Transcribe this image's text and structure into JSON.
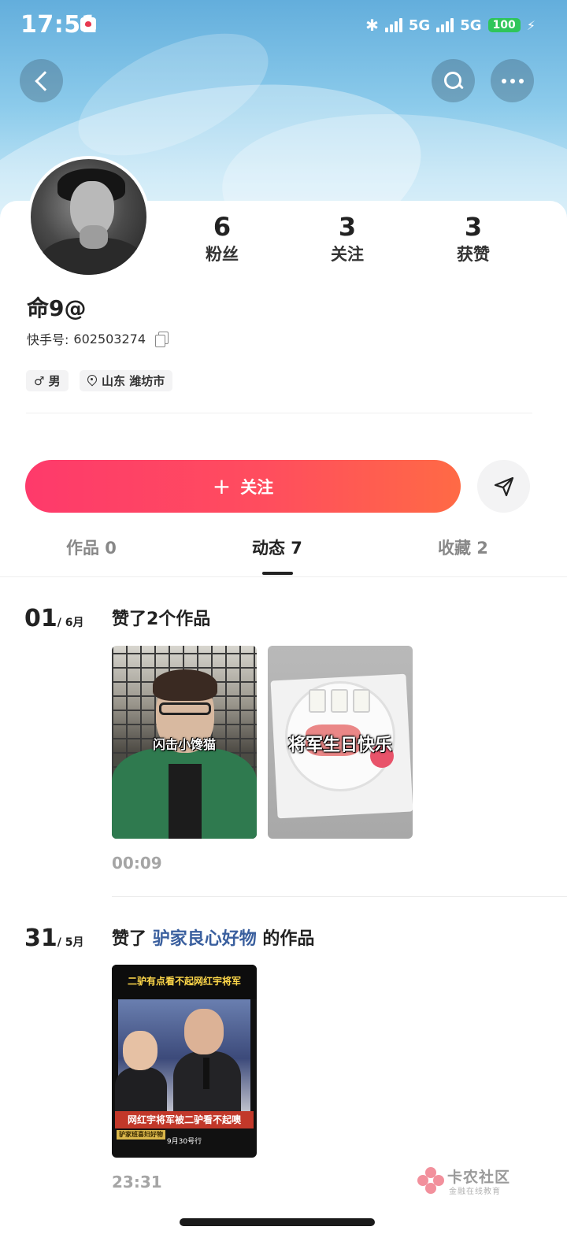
{
  "status_bar": {
    "time": "17:51",
    "network1": "5G",
    "network2": "5G",
    "battery": "100",
    "icons": [
      "bluetooth-icon",
      "signal-icon",
      "battery-icon",
      "charging-icon"
    ]
  },
  "header": {
    "icons": [
      "back-icon",
      "search-icon",
      "more-icon"
    ]
  },
  "profile": {
    "stats": [
      {
        "value": "6",
        "label": "粉丝"
      },
      {
        "value": "3",
        "label": "关注"
      },
      {
        "value": "3",
        "label": "获赞"
      }
    ],
    "nickname": "命9@",
    "kuaishou_id_label": "快手号:",
    "kuaishou_id": "602503274",
    "gender_tag": "♂ 男",
    "location_tag": "山东 潍坊市"
  },
  "actions": {
    "follow_label": "关注",
    "follow_icon": "+",
    "share_icon": "send-icon"
  },
  "tabs": [
    {
      "label": "作品 0",
      "active": false
    },
    {
      "label": "动态 7",
      "active": true
    },
    {
      "label": "收藏 2",
      "active": false
    }
  ],
  "feed": [
    {
      "day": "01",
      "month": "/ 6月",
      "title": "赞了2个作品",
      "thumbnails": [
        {
          "caption": "闪击小馋猫"
        },
        {
          "caption": "将军生日快乐"
        }
      ],
      "time": "00:09"
    },
    {
      "day": "31",
      "month": "/ 5月",
      "title_prefix": "赞了",
      "title_link": "驴家良心好物",
      "title_suffix": "的作品",
      "thumbnails": [
        {
          "top_text": "二驴有点看不起网红宇将军",
          "bottom_text": "网红宇将军被二驴看不起噢",
          "tag": "驴家班喜妇好物",
          "date": "9月30号行"
        }
      ],
      "time": "23:31"
    }
  ],
  "watermark": {
    "main": "卡农社区",
    "sub": "金融在线教育"
  },
  "colors": {
    "follow_gradient_start": "#fe3a6b",
    "follow_gradient_end": "#ff6a45",
    "link": "#3a5f9e",
    "battery": "#2fc55a"
  }
}
